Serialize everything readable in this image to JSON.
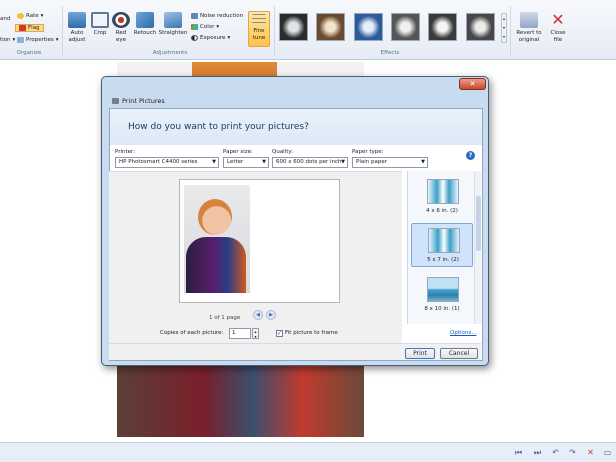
{
  "ribbon": {
    "organize": {
      "label": "Organize",
      "partial_left_top": "and",
      "partial_left_bottom": "tion",
      "rate": "Rate",
      "flag": "Flag",
      "properties": "Properties"
    },
    "adjustments": {
      "label": "Adjustments",
      "auto_adjust": "Auto\nadjust",
      "crop": "Crop",
      "red_eye": "Red\neye",
      "retouch": "Retouch",
      "straighten": "Straighten",
      "noise_reduction": "Noise reduction",
      "color": "Color",
      "exposure": "Exposure",
      "fine_tune": "Fine\ntune"
    },
    "effects": {
      "label": "Effects"
    },
    "revert": "Revert to\noriginal",
    "close_file": "Close\nfile"
  },
  "dialog": {
    "title": "Print Pictures",
    "close_symbol": "✕",
    "prompt": "How do you want to print your pictures?",
    "printer": {
      "label": "Printer:",
      "value": "HP Photosmart C4400 series"
    },
    "paper_size": {
      "label": "Paper size:",
      "value": "Letter"
    },
    "quality": {
      "label": "Quality:",
      "value": "600 x 600 dots per inch"
    },
    "paper_type": {
      "label": "Paper type:",
      "value": "Plain paper"
    },
    "help_symbol": "?",
    "page_count": "1 of 1 page",
    "layouts": [
      {
        "label": "4 x 6 in. (2)"
      },
      {
        "label": "5 x 7 in. (2)"
      },
      {
        "label": "8 x 10 in. (1)"
      }
    ],
    "copies_label": "Copies of each picture:",
    "copies_value": "1",
    "fit_label": "Fit picture to frame",
    "fit_checked": true,
    "options_link": "Options...",
    "print_button": "Print",
    "cancel_button": "Cancel"
  },
  "statusbar": {
    "icons": [
      "first-icon",
      "next-icon",
      "rotate-left-icon",
      "rotate-right-icon",
      "delete-icon",
      "slideshow-icon"
    ]
  },
  "colors": {
    "ribbon_bg": "#e6ecf5",
    "dialog_frame": "#c9dbef",
    "prompt_text": "#1f3a68",
    "link": "#1a5bb5",
    "selected_layout": "#cfe3fb"
  }
}
